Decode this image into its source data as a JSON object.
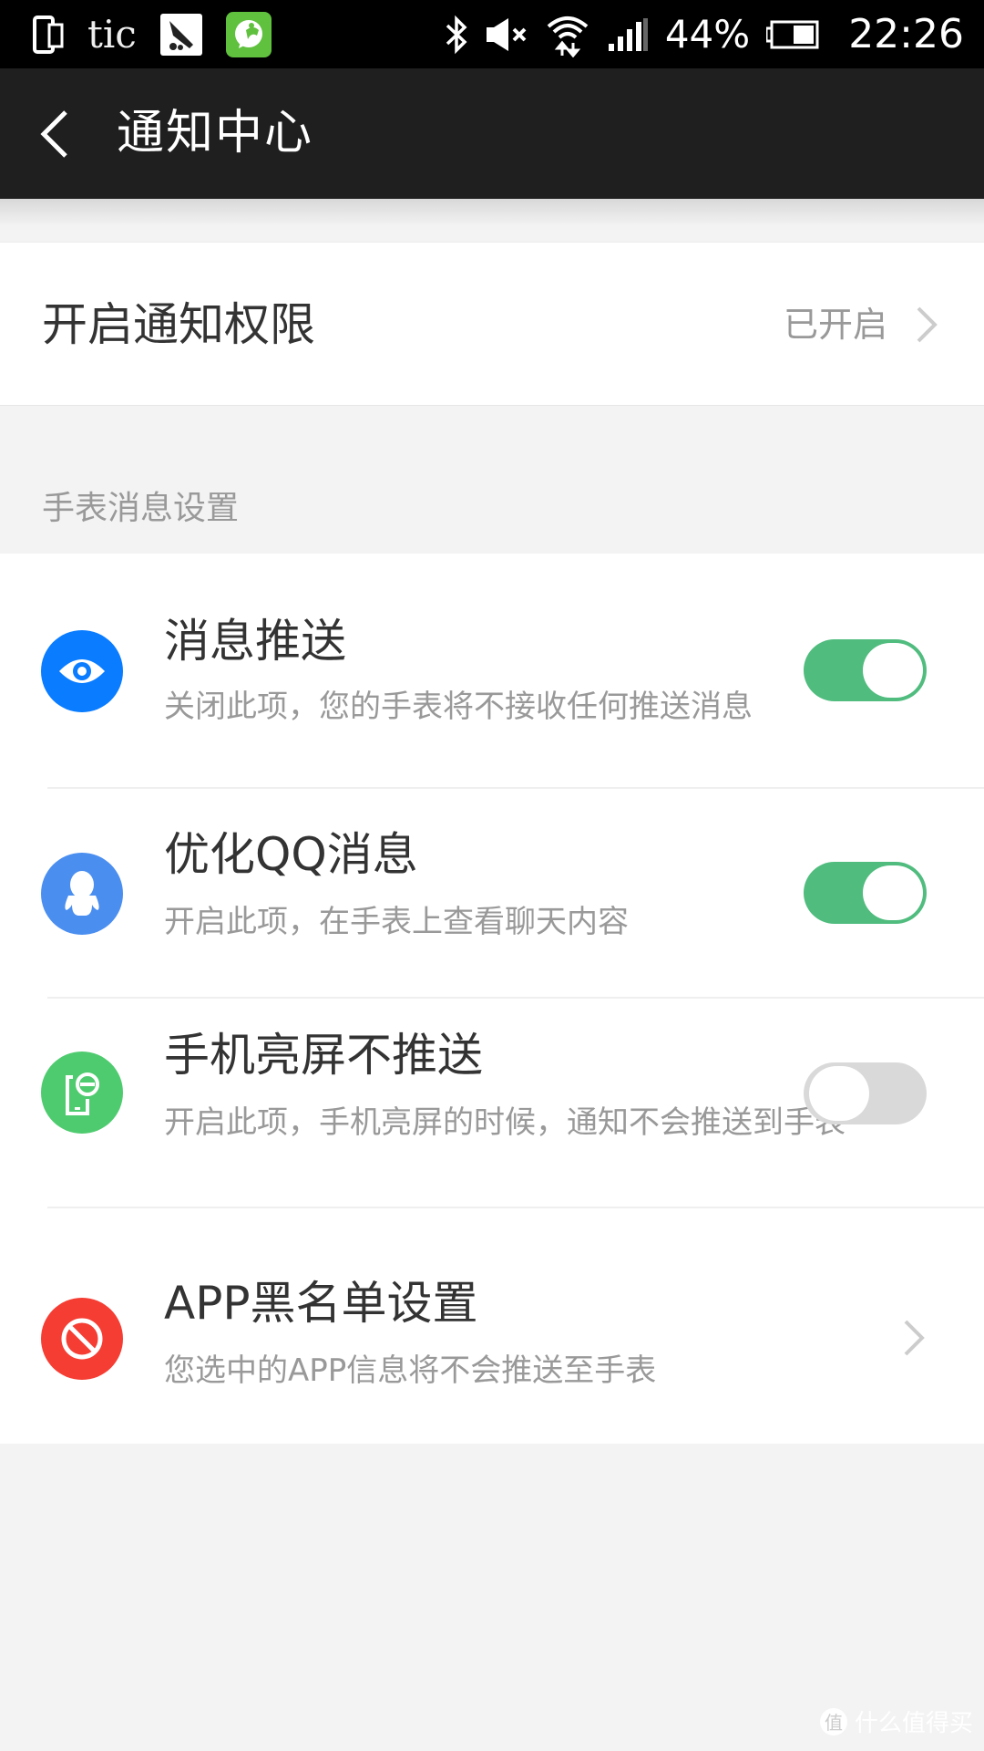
{
  "status_bar": {
    "left_icons": [
      "dual-screen-icon",
      "tic-text",
      "app-notification-icon",
      "app-green-icon"
    ],
    "tic_label": "tic",
    "right_icons": [
      "bluetooth-icon",
      "mute-icon",
      "wifi-icon",
      "signal-icon",
      "battery-icon"
    ],
    "battery_percent": "44%",
    "time": "22:26"
  },
  "app_bar": {
    "back_icon": "chevron-left-icon",
    "title": "通知中心"
  },
  "permission_row": {
    "label": "开启通知权限",
    "status": "已开启"
  },
  "section": {
    "label": "手表消息设置"
  },
  "items": [
    {
      "title": "消息推送",
      "subtitle": "关闭此项，您的手表将不接收任何推送消息",
      "icon": "eye-icon",
      "icon_color": "#0a7cff",
      "control": "toggle",
      "enabled": true
    },
    {
      "title": "优化QQ消息",
      "subtitle": "开启此项，在手表上查看聊天内容",
      "icon": "qq-penguin-icon",
      "icon_color": "#4a8ef0",
      "control": "toggle",
      "enabled": true
    },
    {
      "title": "手机亮屏不推送",
      "subtitle": "开启此项，手机亮屏的时候，通知不会推送到手表",
      "icon": "phone-screen-icon",
      "icon_color": "#4fcb6f",
      "control": "toggle",
      "enabled": false
    },
    {
      "title": "APP黑名单设置",
      "subtitle": "您选中的APP信息将不会推送至手表",
      "icon": "block-icon",
      "icon_color": "#f53d33",
      "control": "chevron"
    }
  ],
  "colors": {
    "toggle_on": "#50bc7e",
    "toggle_off": "#d9d9d9",
    "app_bar_bg": "#1f1f1f",
    "page_bg": "#f3f3f3"
  },
  "watermark": {
    "badge": "值",
    "text": "什么值得买"
  }
}
